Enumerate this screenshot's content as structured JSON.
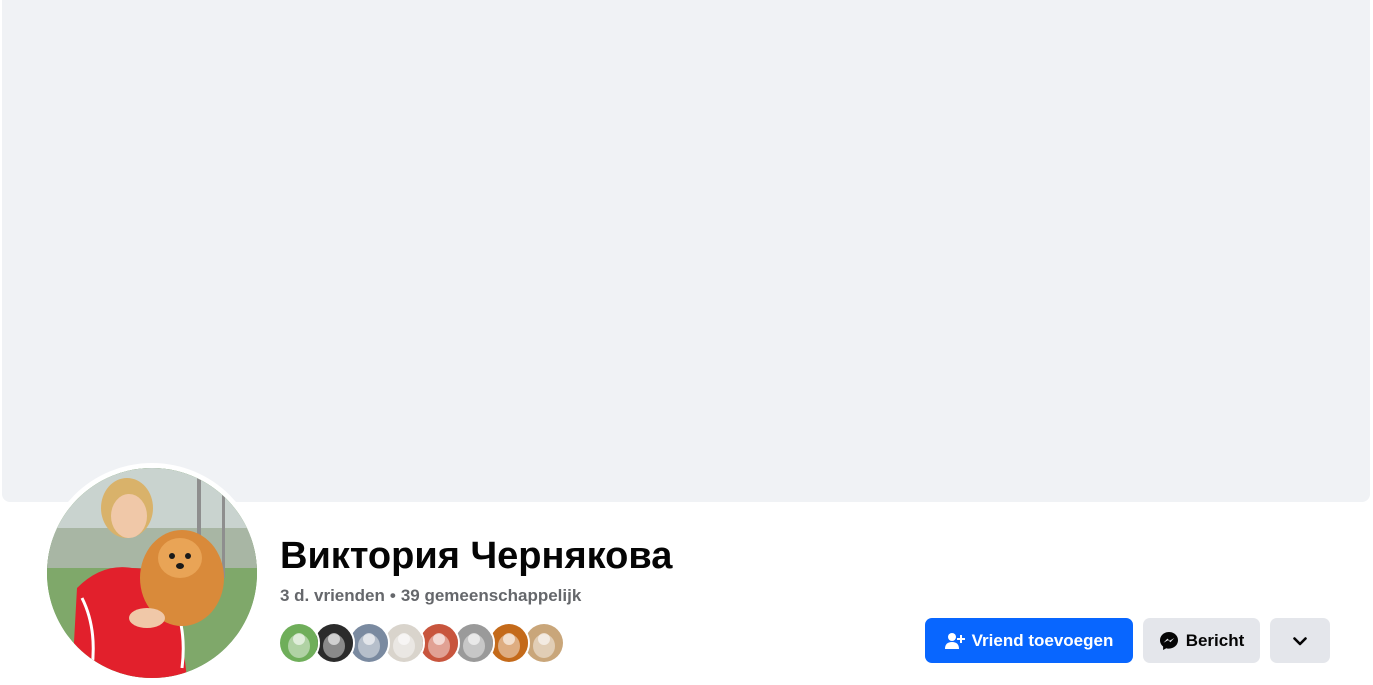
{
  "profile": {
    "name": "Виктория Чернякова",
    "friends_count": "3 d. vrienden",
    "separator": "•",
    "mutual": "39 gemeenschappelijk"
  },
  "friend_avatars": [
    {
      "name": "friend-avatar-1",
      "color": "#6fae5a"
    },
    {
      "name": "friend-avatar-2",
      "color": "#2b2b2b"
    },
    {
      "name": "friend-avatar-3",
      "color": "#7a8aa0"
    },
    {
      "name": "friend-avatar-4",
      "color": "#d9d4cc"
    },
    {
      "name": "friend-avatar-5",
      "color": "#c8553d"
    },
    {
      "name": "friend-avatar-6",
      "color": "#9a9a9a"
    },
    {
      "name": "friend-avatar-7",
      "color": "#c46a1a"
    },
    {
      "name": "friend-avatar-8",
      "color": "#c9a67a"
    }
  ],
  "actions": {
    "add_friend_label": "Vriend toevoegen",
    "message_label": "Bericht",
    "add_friend_icon": "add-friend-icon",
    "message_icon": "messenger-icon",
    "more_icon": "chevron-down-icon"
  },
  "colors": {
    "primary": "#0866ff",
    "secondary_bg": "#e4e6eb",
    "cover_bg": "#f0f2f5",
    "meta_text": "#65676b"
  }
}
